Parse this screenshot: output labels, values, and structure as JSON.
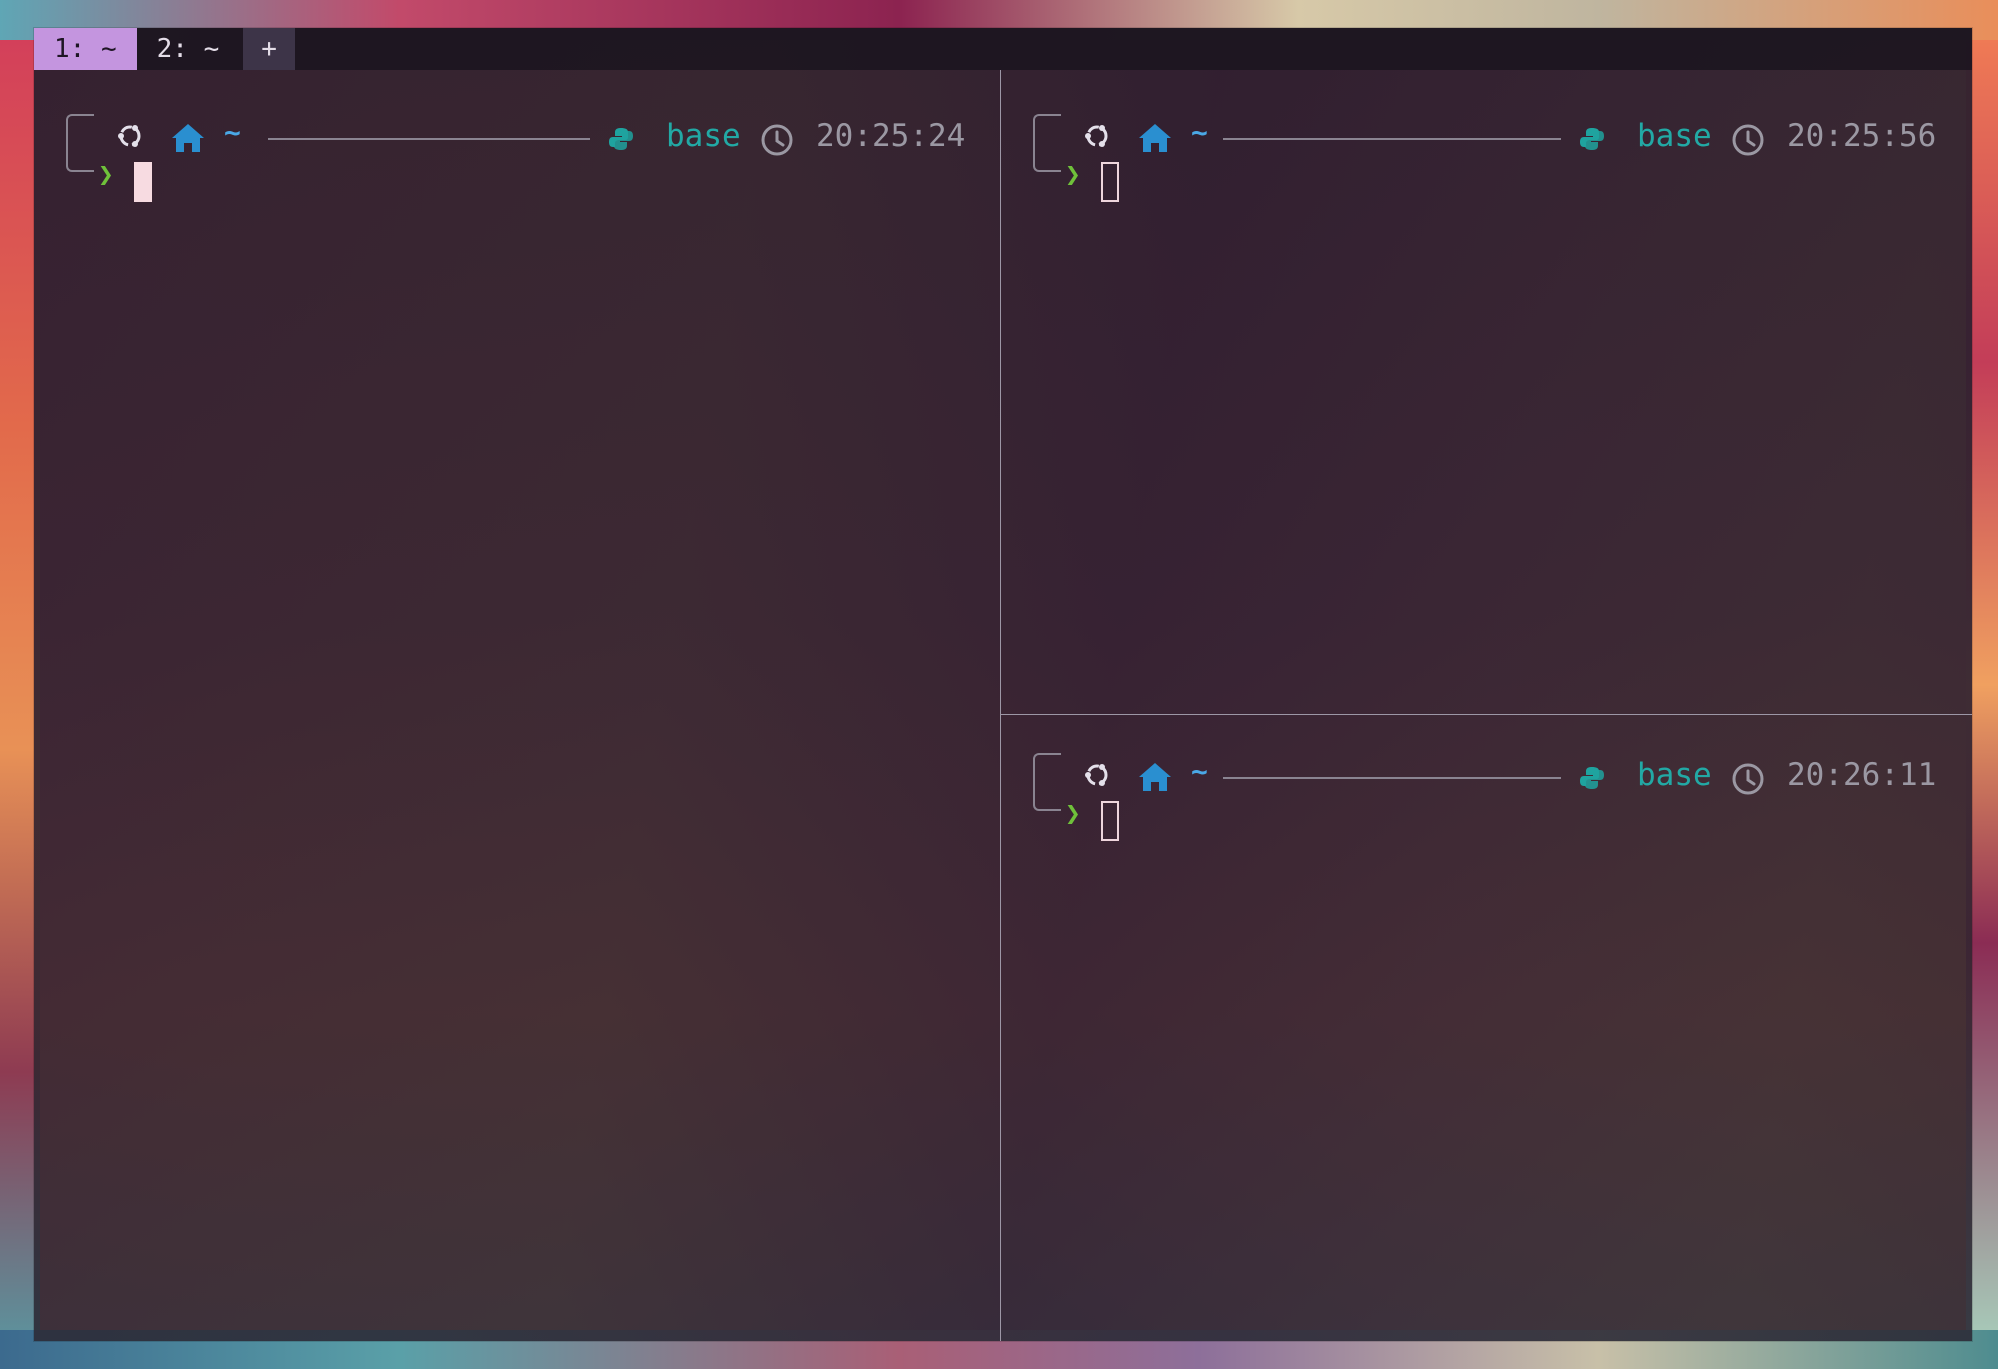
{
  "tabs": [
    {
      "label": "1: ~",
      "active": true
    },
    {
      "label": "2: ~",
      "active": false
    }
  ],
  "new_tab_label": "+",
  "colors": {
    "active_tab": "#c495df",
    "directory": "#4aa8e6",
    "home_icon": "#2a8fd0",
    "env": "#22a9a5",
    "time": "#9b98a3",
    "prompt_chevron": "#6fc13a",
    "cursor": "#f7dbe1"
  },
  "icons": {
    "os": "ubuntu-icon",
    "home": "home-icon",
    "python": "python-icon",
    "clock": "clock-icon"
  },
  "panes": {
    "left": {
      "dir": "~",
      "env": "base",
      "time": "20:25:24",
      "chevron": "❯",
      "focused": true
    },
    "top_right": {
      "dir": "~",
      "env": "base",
      "time": "20:25:56",
      "chevron": "❯",
      "focused": false
    },
    "bottom_right": {
      "dir": "~",
      "env": "base",
      "time": "20:26:11",
      "chevron": "❯",
      "focused": false
    }
  }
}
